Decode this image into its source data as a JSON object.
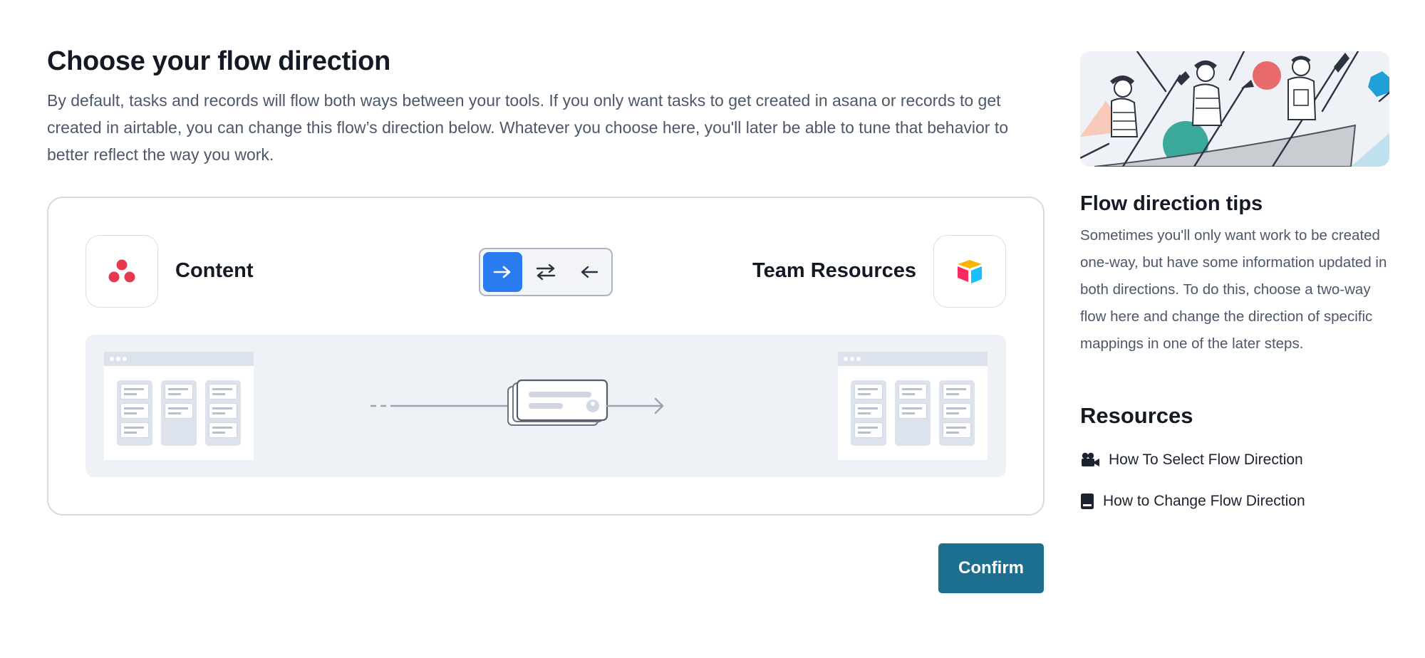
{
  "header": {
    "title": "Choose your flow direction",
    "description": "By default, tasks and records will flow both ways between your tools. If you only want tasks to get created in asana or records to get created in airtable, you can change this flow’s direction below. Whatever you choose here, you'll later be able to tune that behavior to better reflect the way you work."
  },
  "flow": {
    "left_app": {
      "name": "Content",
      "icon": "asana-logo-icon"
    },
    "right_app": {
      "name": "Team Resources",
      "icon": "airtable-logo-icon"
    },
    "directions": [
      {
        "id": "one-way-right",
        "glyph": "→",
        "active": true
      },
      {
        "id": "two-way",
        "glyph": "⇄",
        "active": false
      },
      {
        "id": "one-way-left",
        "glyph": "←",
        "active": false
      }
    ],
    "accent_color": "#2b7bf0"
  },
  "actions": {
    "confirm_label": "Confirm"
  },
  "sidebar": {
    "tips_title": "Flow direction tips",
    "tips_body": "Sometimes you'll only want work to be created one-way, but have some information updated in both directions. To do this, choose a two-way flow here and change the direction of specific mappings in one of the later steps.",
    "resources_title": "Resources",
    "resources": [
      {
        "label": "How To Select Flow Direction",
        "icon": "video-camera-icon"
      },
      {
        "label": "How to Change Flow Direction",
        "icon": "book-icon"
      }
    ]
  },
  "colors": {
    "primary_button": "#1c6f8f",
    "asana": "#e8384f",
    "text_muted": "#4c586a"
  }
}
